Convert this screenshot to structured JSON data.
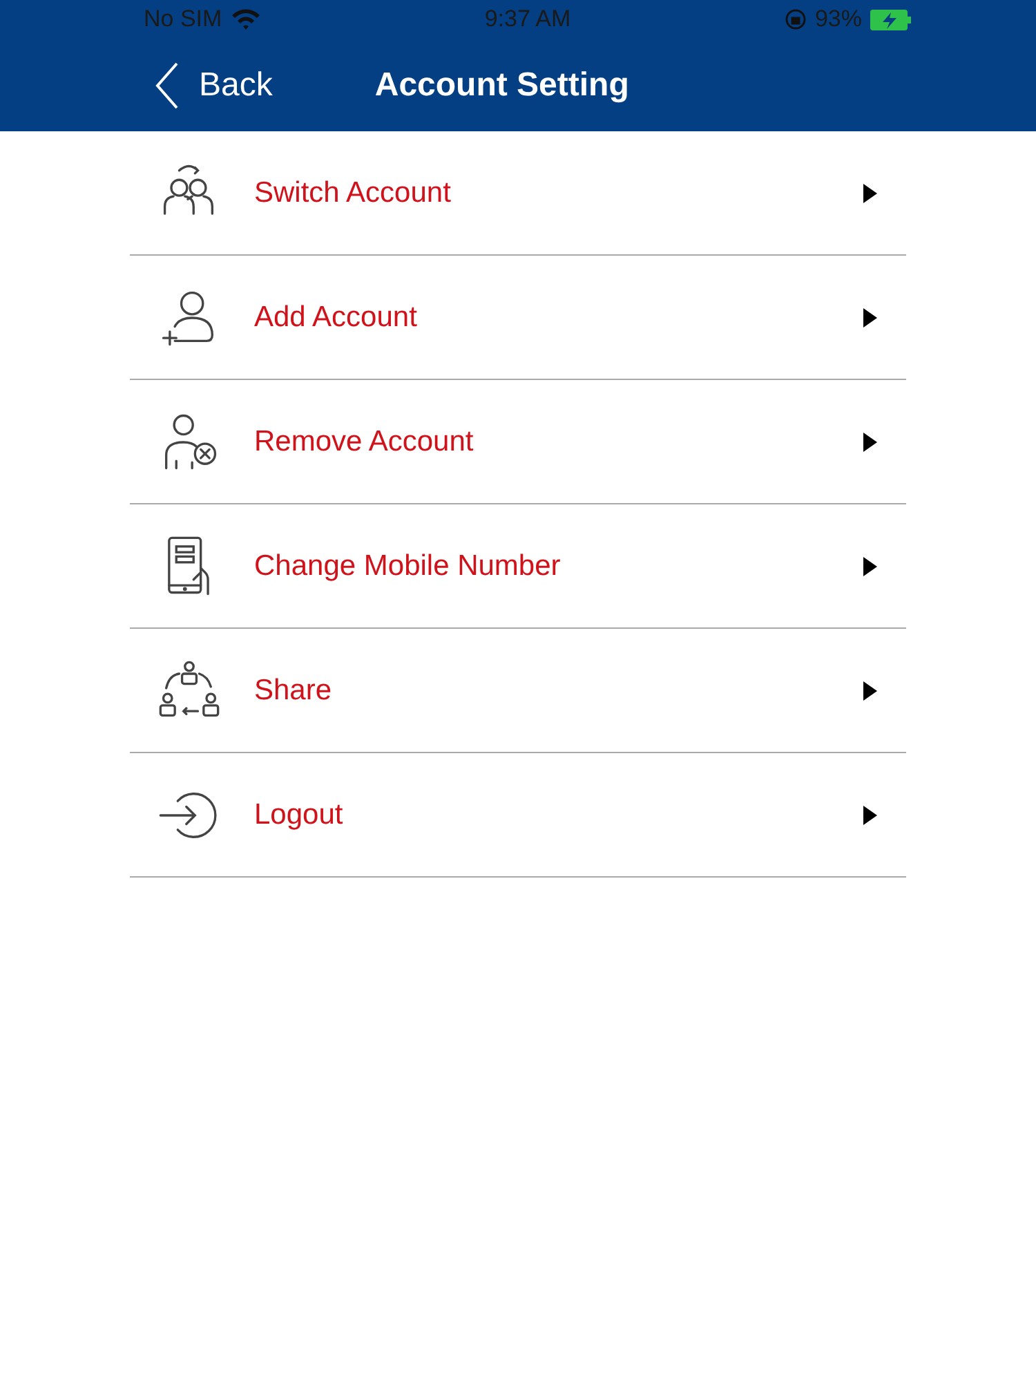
{
  "status_bar": {
    "carrier": "No SIM",
    "time": "9:37 AM",
    "battery": "93%"
  },
  "nav_bar": {
    "back": "Back",
    "title": "Account Setting"
  },
  "menu": [
    {
      "kind": "switch",
      "label": "Switch Account"
    },
    {
      "kind": "add",
      "label": "Add Account"
    },
    {
      "kind": "remove",
      "label": "Remove Account"
    },
    {
      "kind": "mobile",
      "label": "Change Mobile Number"
    },
    {
      "kind": "share",
      "label": "Share"
    },
    {
      "kind": "logout",
      "label": "Logout"
    }
  ]
}
